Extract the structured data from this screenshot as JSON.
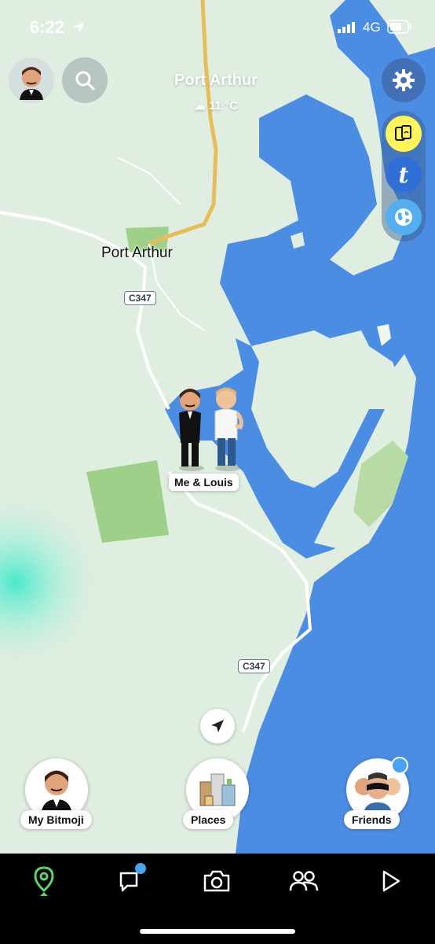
{
  "status_bar": {
    "time": "6:22",
    "network": "4G"
  },
  "header": {
    "city": "Port Arthur",
    "weather": "11 °C"
  },
  "map": {
    "town_label": "Port Arthur",
    "road_signs": [
      "C347",
      "C347"
    ],
    "friend_group_label": "Me & Louis"
  },
  "bottom": {
    "my_bitmoji": "My Bitmoji",
    "places": "Places",
    "friends": "Friends"
  },
  "colors": {
    "water": "#4c8de4",
    "land": "#dfeee0",
    "park": "#9fd08a",
    "road": "#e6bd5a",
    "heat": "#2fe8c9",
    "badge": "#4aa3f2",
    "map_tab_active": "#5fd16b"
  },
  "icons": [
    "location-arrow-icon",
    "signal-icon",
    "battery-icon",
    "search-icon",
    "gear-icon",
    "memories-card-icon",
    "tinder-t-icon",
    "globe-icon",
    "navigate-arrow-icon",
    "map-pin-icon",
    "chat-icon",
    "camera-icon",
    "friends-icon",
    "play-icon"
  ]
}
